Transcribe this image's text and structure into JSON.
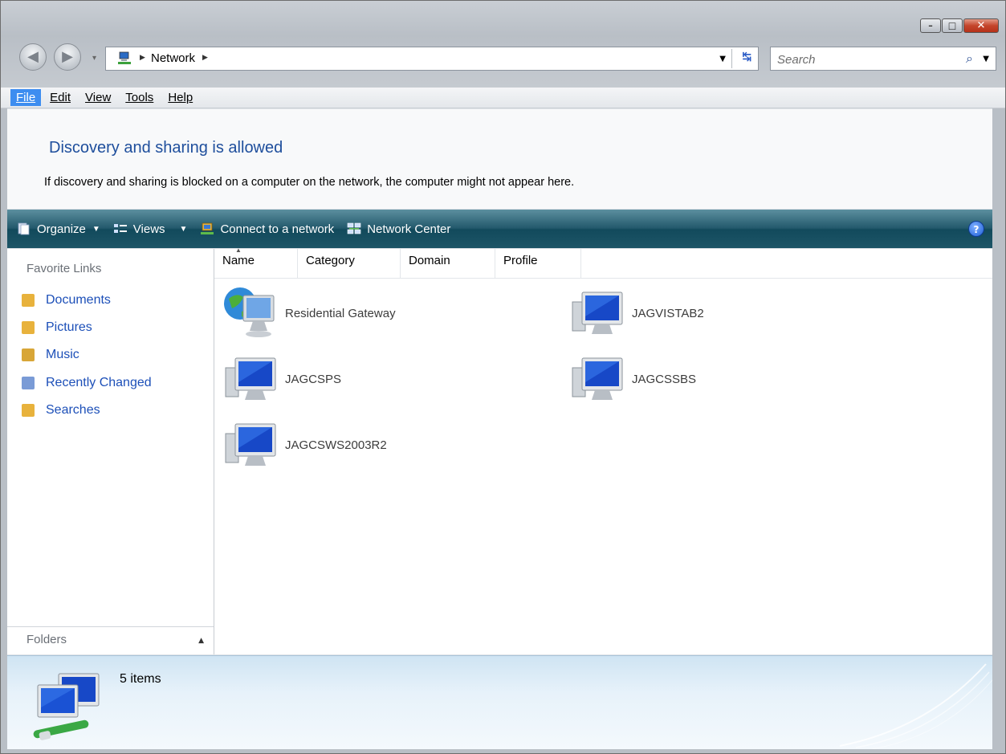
{
  "window": {
    "controls": {
      "minimize": "–",
      "maximize": "□",
      "close": "✕"
    }
  },
  "navigation": {
    "back_icon": "back-arrow-icon",
    "forward_icon": "forward-arrow-icon",
    "history_dropdown": "▾"
  },
  "address_bar": {
    "breadcrumb": [
      "Network"
    ],
    "dropdown_arrow": "▼",
    "refresh_glyph": "↹"
  },
  "search": {
    "placeholder": "Search",
    "icon": "search-icon"
  },
  "menu": {
    "items": [
      {
        "label": "File",
        "active": true
      },
      {
        "label": "Edit",
        "active": false
      },
      {
        "label": "View",
        "active": false
      },
      {
        "label": "Tools",
        "active": false
      },
      {
        "label": "Help",
        "active": false
      }
    ]
  },
  "info_pane": {
    "title": "Discovery and sharing is allowed",
    "text": "If discovery and sharing is blocked on a computer on the network, the computer might not appear here."
  },
  "command_bar": {
    "organize": "Organize",
    "views": "Views",
    "connect": "Connect to a network",
    "network_center": "Network Center",
    "help": "?"
  },
  "nav_pane": {
    "heading": "Favorite Links",
    "links": [
      {
        "label": "Documents",
        "icon": "documents-folder-icon",
        "color": "#e8b23c"
      },
      {
        "label": "Pictures",
        "icon": "pictures-folder-icon",
        "color": "#e8b23c"
      },
      {
        "label": "Music",
        "icon": "music-folder-icon",
        "color": "#d8a637"
      },
      {
        "label": "Recently Changed",
        "icon": "recently-changed-folder-icon",
        "color": "#7a9bd6"
      },
      {
        "label": "Searches",
        "icon": "searches-folder-icon",
        "color": "#e8b23c"
      }
    ],
    "folders_label": "Folders",
    "folders_caret": "▲"
  },
  "columns": [
    "Name",
    "Category",
    "Domain",
    "Profile"
  ],
  "items": [
    {
      "name": "Residential Gateway",
      "icon": "gateway-icon"
    },
    {
      "name": "JAGVISTAB2",
      "icon": "computer-icon"
    },
    {
      "name": "JAGCSPS",
      "icon": "computer-icon"
    },
    {
      "name": "JAGCSSBS",
      "icon": "computer-icon"
    },
    {
      "name": "JAGCSWS2003R2",
      "icon": "computer-icon"
    }
  ],
  "status_bar": {
    "count": "5 items",
    "icon": "network-icon"
  },
  "colors": {
    "command_bar": "#23596c",
    "link_blue": "#1c4fb8",
    "title_blue": "#1e4e9c",
    "menu_active": "#3d8df0"
  }
}
